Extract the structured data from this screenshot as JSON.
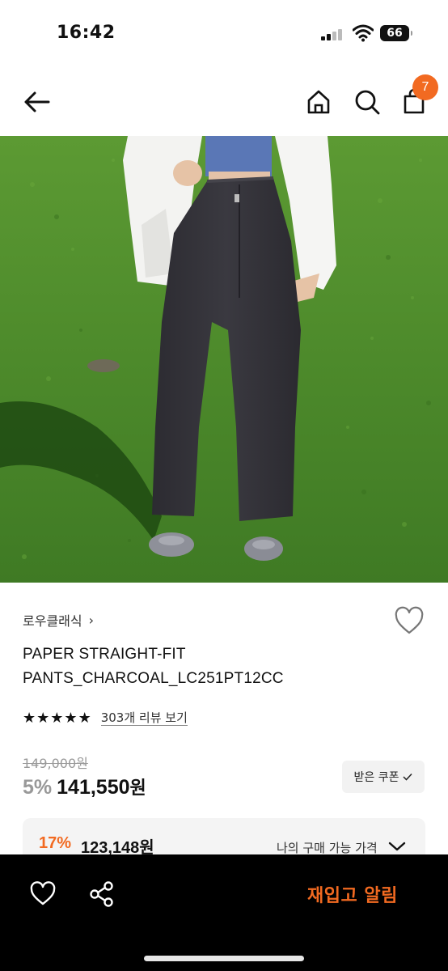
{
  "status_bar": {
    "time": "16:42",
    "battery": "66"
  },
  "header": {
    "cart_count": "7",
    "icons": [
      "back-arrow-icon",
      "home-icon",
      "search-icon",
      "cart-icon"
    ]
  },
  "product": {
    "brand": "로우클래식",
    "brand_chevron": "›",
    "title": "PAPER STRAIGHT-FIT PANTS_CHARCOAL_LC251PT12CC",
    "rating": 5,
    "stars": [
      "★",
      "★",
      "★",
      "★",
      "★"
    ],
    "review_link": "303개 리뷰 보기",
    "original_price": "149,000원",
    "discount_rate": "5%",
    "sale_price": "141,550",
    "currency": "원",
    "coupon_button": "받은 쿠폰",
    "my_price": {
      "discount_rate": "17%",
      "price": "123,148원",
      "label": "나의 구매 가능 가격"
    }
  },
  "bottom_bar": {
    "restock_button": "재입고 알림",
    "icons": [
      "heart-icon",
      "share-icon"
    ]
  },
  "colors": {
    "accent": "#f26a21",
    "bottom_bar": "#000000",
    "grass": "#4f8c2a",
    "pants": "#35343a"
  }
}
